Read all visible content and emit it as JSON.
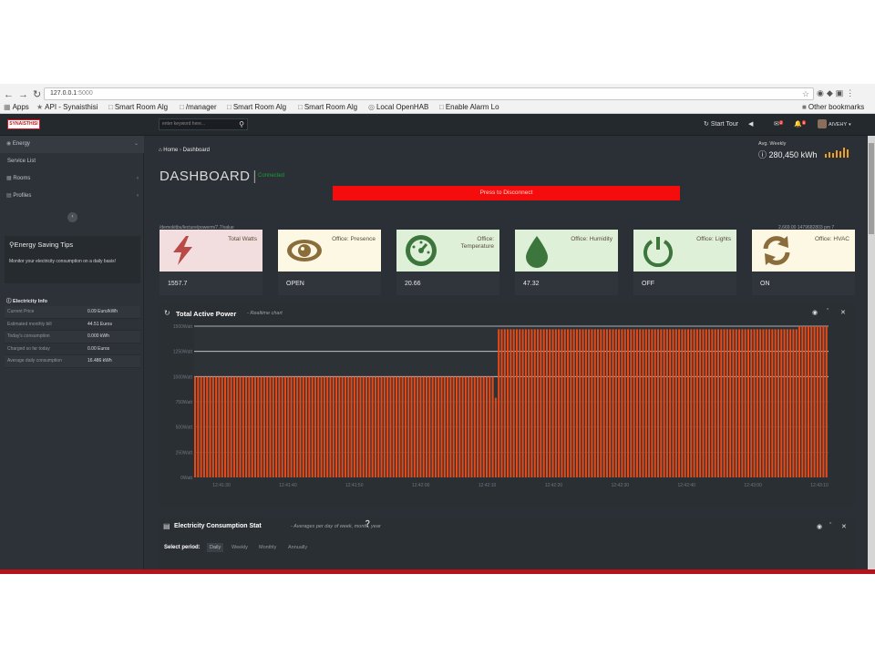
{
  "browser": {
    "url_host": "127.0.0.1",
    "url_port": ":5000",
    "bookmarks": [
      "Apps",
      "API - Synaisthisi",
      "Smart Room Alg",
      "/manager",
      "Smart Room Alg",
      "Smart Room Alg",
      "Local OpenHAB",
      "Enable Alarm Lo",
      "Other bookmarks"
    ]
  },
  "topbar": {
    "logo": "SYNAISTHISI",
    "search_placeholder": "enter keyword here...",
    "start_tour": "Start Tour",
    "mail_badge": "2",
    "bell_badge": "8",
    "user": "AIVEHY"
  },
  "sidebar": {
    "items": [
      {
        "label": "Energy",
        "icon": "dashboard-icon"
      },
      {
        "label": "Service List"
      },
      {
        "label": "Rooms",
        "icon": "rooms-icon"
      },
      {
        "label": "Profiles",
        "icon": "chart-icon"
      }
    ],
    "tips": {
      "title": "Energy Saving Tips",
      "body": "Monitor your electricity consumption on a daily basis!"
    },
    "electricity_info": {
      "title": "Electricity Info",
      "rows": [
        {
          "label": "Current Price",
          "value": "0.09 Euro/kWh"
        },
        {
          "label": "Estimated monthly bill",
          "value": "44.51 Euros"
        },
        {
          "label": "Today's consumption",
          "value": "0.000 kWh"
        },
        {
          "label": "Charged so far today",
          "value": "0.00 Euros"
        },
        {
          "label": "Average daily consumption",
          "value": "16.486 kWh"
        }
      ]
    }
  },
  "main": {
    "breadcrumb": {
      "home": "Home",
      "current": "Dashboard"
    },
    "avg_weekly": {
      "label": "Avg. Weekly",
      "value": "280,450 kWh"
    },
    "title": "DASHBOARD",
    "status": "Connected",
    "disconnect_label": "Press to Disconnect",
    "topic": "/demokitbu/lecture/powerm/7.7/value",
    "topic_timestamp": "2,669.00 1479682803 pm 7",
    "cards": [
      {
        "title": "Total Watts",
        "value": "1557.7",
        "icon": "lightning-icon",
        "bg": "#f2dede",
        "fg": "#b94a48"
      },
      {
        "title": "Office: Presence",
        "value": "OPEN",
        "icon": "eye-icon",
        "bg": "#fcf8e3",
        "fg": "#8a6d3b"
      },
      {
        "title": "Office: Temperature",
        "value": "20.66",
        "icon": "gauge-icon",
        "bg": "#dff0d8",
        "fg": "#3c763d"
      },
      {
        "title": "Office: Humidity",
        "value": "47.32",
        "icon": "drop-icon",
        "bg": "#dff0d8",
        "fg": "#3c763d"
      },
      {
        "title": "Office: Lights",
        "value": "OFF",
        "icon": "power-icon",
        "bg": "#dff0d8",
        "fg": "#3c763d"
      },
      {
        "title": "Office: HVAC",
        "value": "ON",
        "icon": "refresh-icon",
        "bg": "#fcf8e3",
        "fg": "#8a6d3b"
      }
    ],
    "chart_panel": {
      "title": "Total Active Power",
      "subtitle": "- Realtime chart"
    },
    "stat_panel": {
      "title": "Electricity Consumption Stat",
      "subtitle": "- Averages per day of week, month, year",
      "period_label": "Select period:",
      "periods": [
        "Daily",
        "Weekly",
        "Monthly",
        "Annually"
      ],
      "selected": "Daily"
    }
  },
  "chart_data": {
    "type": "bar",
    "title": "Total Active Power",
    "ylim": [
      0,
      1500
    ],
    "yticks": [
      "0Watt",
      "250Watt",
      "500Watt",
      "750Watt",
      "1000Watt",
      "1250Watt",
      "1500Watt"
    ],
    "xticks": [
      "12:41:30",
      "12:41:40",
      "12:41:50",
      "12:42:00",
      "12:42:10",
      "12:42:20",
      "12:42:30",
      "12:42:40",
      "12:43:00",
      "12:43:10"
    ],
    "bar_color": "#e64a19",
    "segments": [
      {
        "count": 100,
        "value": 1000
      },
      {
        "count": 1,
        "value": 790
      },
      {
        "count": 100,
        "value": 1470
      },
      {
        "count": 10,
        "value": 1500
      }
    ],
    "grid": true
  }
}
